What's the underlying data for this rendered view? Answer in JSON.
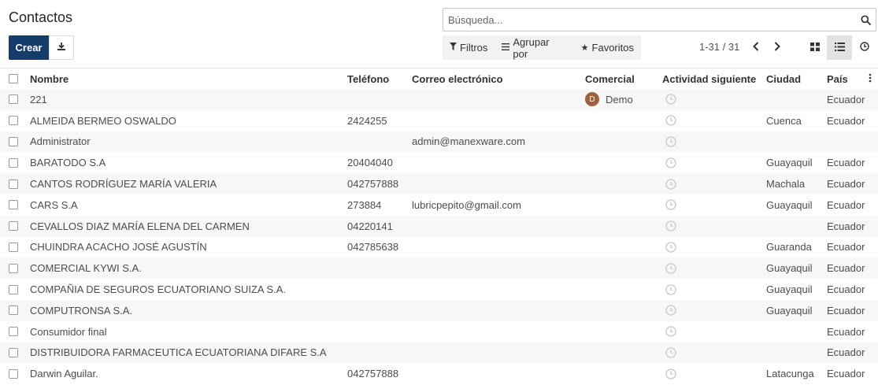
{
  "page": {
    "title": "Contactos"
  },
  "search": {
    "placeholder": "Búsqueda..."
  },
  "toolbar": {
    "create_label": "Crear"
  },
  "filters": {
    "filters_label": "Filtros",
    "group_label": "Agrupar por",
    "favorites_label": "Favoritos"
  },
  "pager": {
    "range": "1-31 / 31"
  },
  "icons": {
    "search": "search-icon",
    "download": "download-icon",
    "filter": "filter-icon",
    "group": "group-by-icon",
    "favorites": "star-icon",
    "prev": "chevron-left-icon",
    "next": "chevron-right-icon",
    "kanban": "kanban-view-icon",
    "list": "list-view-icon",
    "activity": "clock-icon"
  },
  "colors": {
    "primary": "#163c6c",
    "avatar": "#a0613a",
    "active_view": "#e2e2e2"
  },
  "table": {
    "columns": {
      "name": "Nombre",
      "phone": "Teléfono",
      "email": "Correo electrónico",
      "salesperson": "Comercial",
      "activity": "Actividad siguiente",
      "city": "Ciudad",
      "country": "País"
    },
    "rows": [
      {
        "name": "221",
        "phone": "",
        "email": "",
        "salesperson": "Demo",
        "avatar": "D",
        "city": "",
        "country": "Ecuador"
      },
      {
        "name": "ALMEIDA BERMEO OSWALDO",
        "phone": "2424255",
        "email": "",
        "salesperson": "",
        "avatar": "",
        "city": "Cuenca",
        "country": "Ecuador"
      },
      {
        "name": "Administrator",
        "phone": "",
        "email": "admin@manexware.com",
        "salesperson": "",
        "avatar": "",
        "city": "",
        "country": ""
      },
      {
        "name": "BARATODO S.A",
        "phone": "20404040",
        "email": "",
        "salesperson": "",
        "avatar": "",
        "city": "Guayaquil",
        "country": "Ecuador"
      },
      {
        "name": "CANTOS RODRÍGUEZ MARÍA VALERIA",
        "phone": "042757888",
        "email": "",
        "salesperson": "",
        "avatar": "",
        "city": "Machala",
        "country": "Ecuador"
      },
      {
        "name": "CARS S.A",
        "phone": "273884",
        "email": "lubricpepito@gmail.com",
        "salesperson": "",
        "avatar": "",
        "city": "Guayaquil",
        "country": "Ecuador"
      },
      {
        "name": "CEVALLOS DIAZ MARÍA ELENA DEL CARMEN",
        "phone": "04220141",
        "email": "",
        "salesperson": "",
        "avatar": "",
        "city": "",
        "country": "Ecuador"
      },
      {
        "name": "CHUINDRA ACACHO JOSÉ AGUSTÍN",
        "phone": "042785638",
        "email": "",
        "salesperson": "",
        "avatar": "",
        "city": "Guaranda",
        "country": "Ecuador"
      },
      {
        "name": "COMERCIAL KYWI S.A.",
        "phone": "",
        "email": "",
        "salesperson": "",
        "avatar": "",
        "city": "Guayaquil",
        "country": "Ecuador"
      },
      {
        "name": "COMPAÑIA DE SEGUROS ECUATORIANO SUIZA S.A.",
        "phone": "",
        "email": "",
        "salesperson": "",
        "avatar": "",
        "city": "Guayaquil",
        "country": "Ecuador"
      },
      {
        "name": "COMPUTRONSA S.A.",
        "phone": "",
        "email": "",
        "salesperson": "",
        "avatar": "",
        "city": "Guayaquil",
        "country": "Ecuador"
      },
      {
        "name": "Consumidor final",
        "phone": "",
        "email": "",
        "salesperson": "",
        "avatar": "",
        "city": "",
        "country": "Ecuador"
      },
      {
        "name": "DISTRIBUIDORA FARMACEUTICA ECUATORIANA DIFARE S.A",
        "phone": "",
        "email": "",
        "salesperson": "",
        "avatar": "",
        "city": "",
        "country": "Ecuador"
      },
      {
        "name": "Darwin Aguilar.",
        "phone": "042757888",
        "email": "",
        "salesperson": "",
        "avatar": "",
        "city": "Latacunga",
        "country": "Ecuador"
      }
    ]
  }
}
